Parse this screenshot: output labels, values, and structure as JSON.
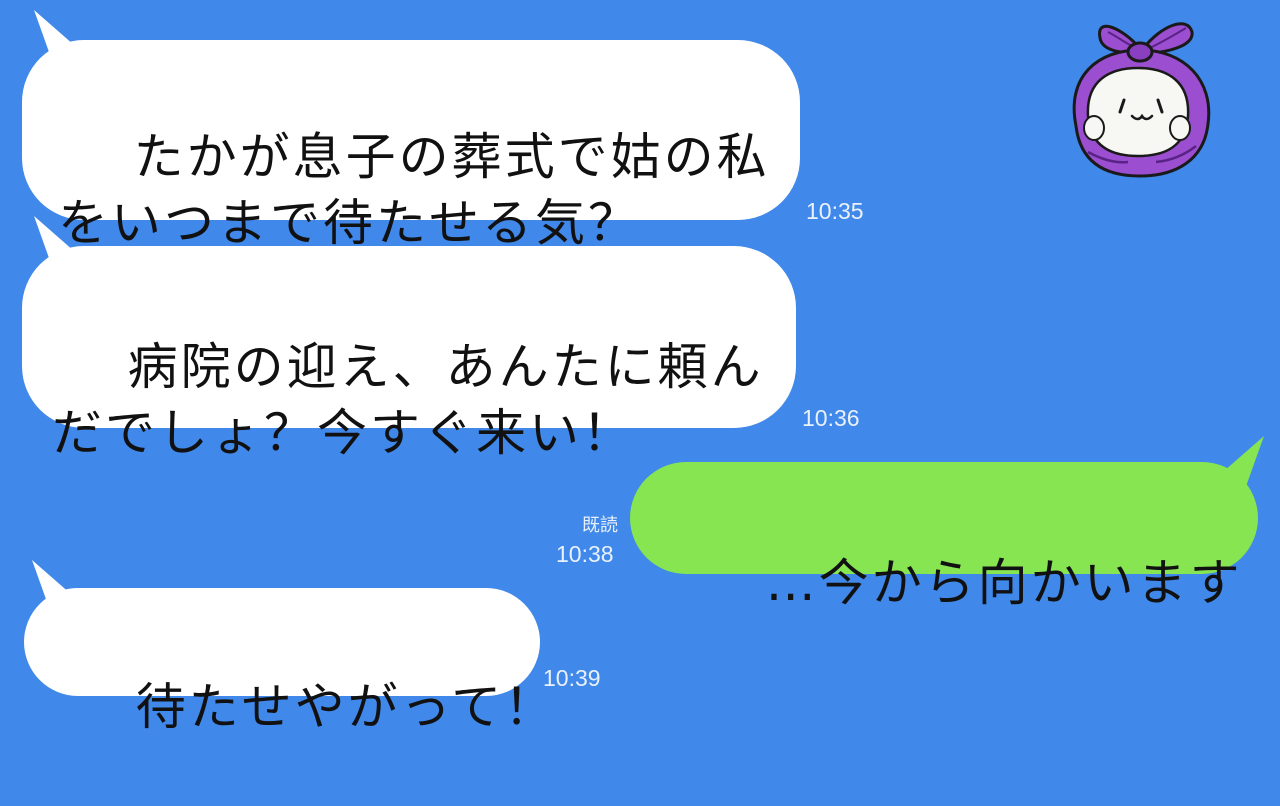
{
  "colors": {
    "background": "#4088e9",
    "incoming_bubble": "#ffffff",
    "outgoing_bubble": "#86e551",
    "timestamp_text": "#e9f1fb",
    "avatar_wrap": "#9b4fd0"
  },
  "avatar": {
    "icon": "purple-furoshiki-mochi-avatar"
  },
  "messages": [
    {
      "direction": "incoming",
      "text": "たかが息子の葬式で姑の私\nをいつまで待たせる気？",
      "time": "10:35"
    },
    {
      "direction": "incoming",
      "text": "病院の迎え、あんたに頼ん\nだでしょ？今すぐ来い！",
      "time": "10:36"
    },
    {
      "direction": "outgoing",
      "text": "…今から向かいます",
      "time": "10:38",
      "read_label": "既読"
    },
    {
      "direction": "incoming",
      "text": "待たせやがって！",
      "time": "10:39"
    }
  ]
}
